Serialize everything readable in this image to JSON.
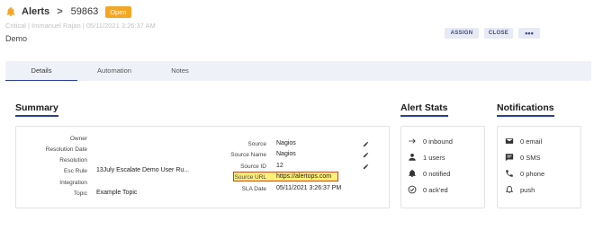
{
  "header": {
    "app": "Alerts",
    "separator": ">",
    "alert_id": "59863",
    "status": "Open",
    "meta": "Critical | Immanuel Rajan | 05/11/2021 3:26:37 AM",
    "description": "Demo"
  },
  "actions": {
    "assign": "ASSIGN",
    "close": "CLOSE",
    "more": "•••"
  },
  "tabs": [
    {
      "label": "Details"
    },
    {
      "label": "Automation"
    },
    {
      "label": "Notes"
    }
  ],
  "summary": {
    "title": "Summary",
    "left": [
      {
        "label": "Owner",
        "value": ""
      },
      {
        "label": "Resolution Date",
        "value": ""
      },
      {
        "label": "Resolution",
        "value": ""
      },
      {
        "label": "Esc Rule",
        "value": "13July Escalate Demo User Ru..."
      },
      {
        "label": "Integration",
        "value": ""
      },
      {
        "label": "Topic",
        "value": "Example Topic"
      }
    ],
    "right": [
      {
        "label": "Source",
        "value": "Nagios"
      },
      {
        "label": "Source Name",
        "value": "Nagios"
      },
      {
        "label": "Source ID",
        "value": "12"
      },
      {
        "label": "Source URL",
        "value": "https://alertops.com"
      },
      {
        "label": "SLA Date",
        "value": "05/11/2021 3:26:37 PM"
      }
    ]
  },
  "alert_stats": {
    "title": "Alert Stats",
    "items": [
      {
        "icon": "arrow-right-icon",
        "text": "0 inbound"
      },
      {
        "icon": "user-icon",
        "text": "1 users"
      },
      {
        "icon": "bell-icon",
        "text": "0 notified"
      },
      {
        "icon": "check-circle-icon",
        "text": "0 ack'ed"
      }
    ]
  },
  "notifications": {
    "title": "Notifications",
    "items": [
      {
        "icon": "envelope-icon",
        "text": "0 email"
      },
      {
        "icon": "message-icon",
        "text": "0 SMS"
      },
      {
        "icon": "phone-icon",
        "text": "0 phone"
      },
      {
        "icon": "bell-outline-icon",
        "text": "push"
      }
    ]
  },
  "colors": {
    "accent": "#2c3e94",
    "badge": "#f5a623",
    "highlight": "#fff176",
    "highlight_border": "#c93a2f"
  }
}
